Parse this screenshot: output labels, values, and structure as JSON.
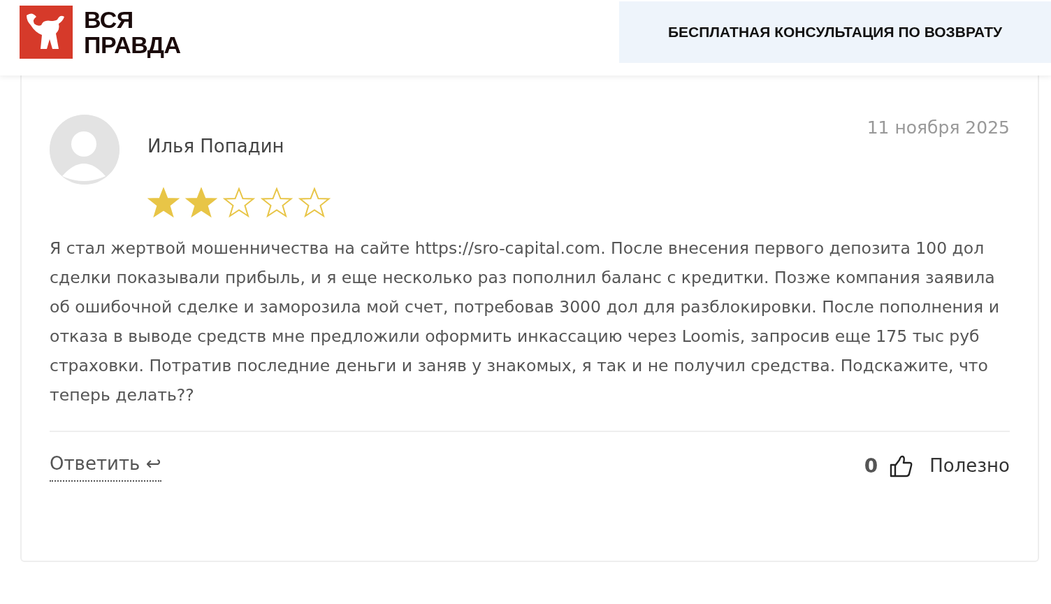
{
  "header": {
    "logo_lines": [
      "ВСЯ",
      "ПРАВДА"
    ],
    "cta_button": "БЕСПЛАТНАЯ КОНСУЛЬТАЦИЯ ПО ВОЗВРАТУ"
  },
  "review": {
    "author": "Илья Попадин",
    "date": "11 ноября 2025",
    "stars": 2,
    "text": "Я стал жертвой мошенничества на сайте https://sro-capital.com. После внесения первого депозита 100 дол сделки показывали прибыль, и я еще несколько раз пополнил баланс с кредитки. Позже компания заявила об ошибочной сделке и заморозила мой счет, потребовав 3000 дол для разблокировки. После пополнения и отказа в выводе средств мне предложили оформить инкассацию через Loomis, запросив еще 175 тыс руб страховки. Потратив последние деньги и заняв у знакомых, я так и не получил средства. Подскажите, что теперь делать??",
    "reply_link": "Ответить",
    "reply_arrow": "↩",
    "useful_count": "0",
    "useful_label": "Полезно"
  }
}
